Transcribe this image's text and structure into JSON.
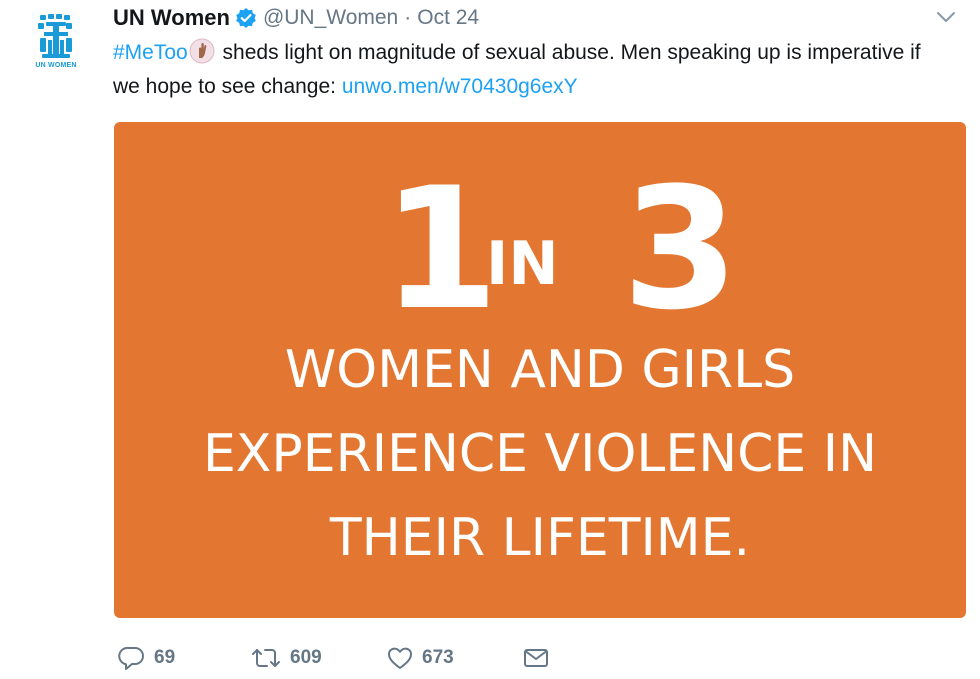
{
  "tweet": {
    "author": {
      "display_name": "UN Women",
      "handle": "@UN_Women",
      "avatar_label": "UN WOMEN",
      "verified": true
    },
    "separator": "·",
    "date": "Oct 24",
    "text": {
      "hashtag": "#MeToo",
      "body_part1": " sheds light on magnitude of sexual abuse. Men speaking up is imperative if we hope to see change: ",
      "link": "unwo.men/w70430g6exY"
    },
    "media": {
      "stat_one": "1",
      "stat_in": "IN",
      "stat_three": "3",
      "line1": "WOMEN AND GIRLS",
      "line2": "EXPERIENCE VIOLENCE IN",
      "line3": "THEIR LIFETIME.",
      "background_color": "#e37631"
    },
    "actions": {
      "reply_count": "69",
      "retweet_count": "609",
      "like_count": "673"
    }
  },
  "colors": {
    "link": "#1da1f2",
    "muted": "#657786",
    "text": "#14171a",
    "brand_blue": "#1a9ad6"
  },
  "icons": [
    "un-women-logo-icon",
    "verified-badge-icon",
    "chevron-down-icon",
    "raised-hand-emoji-icon",
    "reply-icon",
    "retweet-icon",
    "like-icon",
    "direct-message-icon"
  ]
}
